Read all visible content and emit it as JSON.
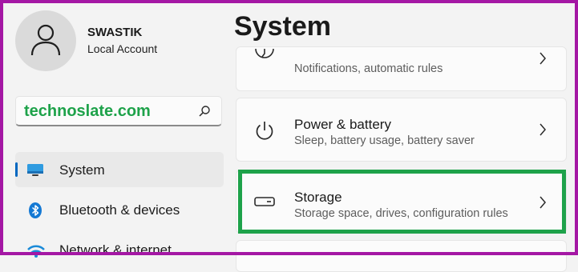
{
  "user": {
    "name": "SWASTIK",
    "account_type": "Local Account"
  },
  "search": {
    "value": "technoslate.com",
    "icon": "search-icon"
  },
  "sidebar": {
    "items": [
      {
        "label": "System",
        "icon": "system-icon",
        "active": true
      },
      {
        "label": "Bluetooth & devices",
        "icon": "bluetooth-icon",
        "active": false
      },
      {
        "label": "Network & internet",
        "icon": "wifi-icon",
        "active": false
      }
    ]
  },
  "main": {
    "title": "System",
    "cards": [
      {
        "title": "",
        "subtitle": "Notifications, automatic rules",
        "icon": "focus-icon"
      },
      {
        "title": "Power & battery",
        "subtitle": "Sleep, battery usage, battery saver",
        "icon": "power-icon"
      },
      {
        "title": "Storage",
        "subtitle": "Storage space, drives, configuration rules",
        "icon": "storage-icon"
      }
    ]
  },
  "colors": {
    "accent": "#0067c0",
    "highlight": "#1ea24a",
    "frame": "#a417a4",
    "search_text": "#1ea24a"
  }
}
